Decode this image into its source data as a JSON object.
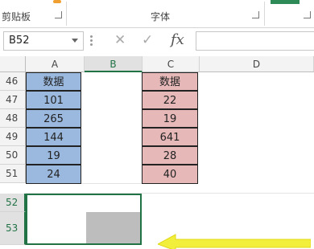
{
  "ribbon": {
    "clipboard_label": "剪贴板",
    "font_label": "字体"
  },
  "namebox": {
    "value": "B52"
  },
  "formula": {
    "fx_label": "fx",
    "cancel_glyph": "✕",
    "enter_glyph": "✓",
    "value": ""
  },
  "columns": [
    "A",
    "B",
    "C",
    "D"
  ],
  "rows": [
    "46",
    "47",
    "48",
    "49",
    "50",
    "51",
    "52",
    "53"
  ],
  "col_a": [
    "数据",
    "101",
    "265",
    "144",
    "19",
    "24"
  ],
  "col_c": [
    "数据",
    "22",
    "19",
    "641",
    "28",
    "40"
  ],
  "colors": {
    "col_a_fill": "#9bb9de",
    "col_c_fill": "#e6b8b8",
    "selection": "#217346",
    "arrow": "#f2ef3c"
  }
}
